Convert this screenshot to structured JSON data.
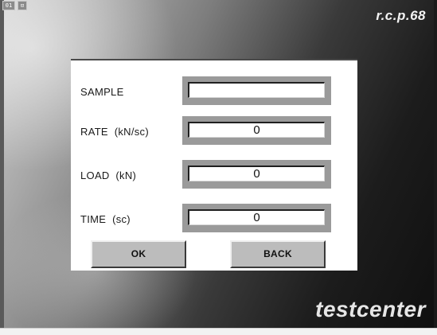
{
  "system": {
    "box1": "01",
    "box2": "⊡"
  },
  "brand": {
    "top": "r.c.p.68",
    "bottom": "testcenter"
  },
  "dialog": {
    "fields": [
      {
        "label": "SAMPLE",
        "value": ""
      },
      {
        "label": "RATE  (kN/sc)",
        "value": "0"
      },
      {
        "label": "LOAD  (kN)",
        "value": "0"
      },
      {
        "label": "TIME  (sc)",
        "value": "0"
      }
    ],
    "ok_label": "OK",
    "back_label": "BACK"
  }
}
